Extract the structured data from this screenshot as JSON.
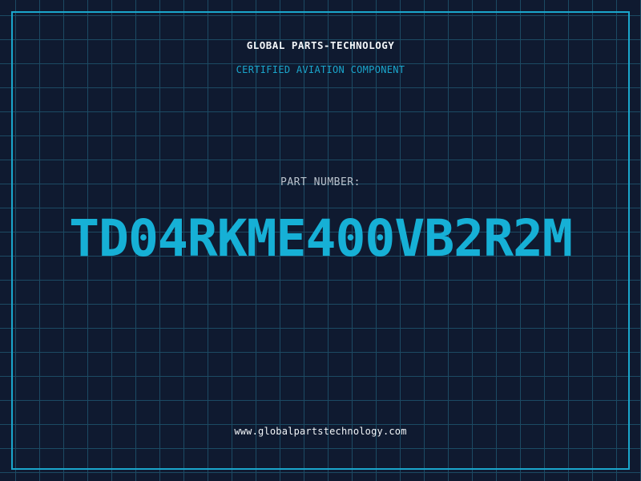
{
  "company": "GLOBAL PARTS-TECHNOLOGY",
  "subtitle": "CERTIFIED AVIATION COMPONENT",
  "part_number_label": "PART NUMBER:",
  "part_number": "TD04RKME400VB2R2M",
  "website": "www.globalpartstechnology.com",
  "colors": {
    "background": "#0f1a30",
    "grid": "#1c4a63",
    "accent": "#1aa6cc",
    "text": "#f2f5f8"
  }
}
